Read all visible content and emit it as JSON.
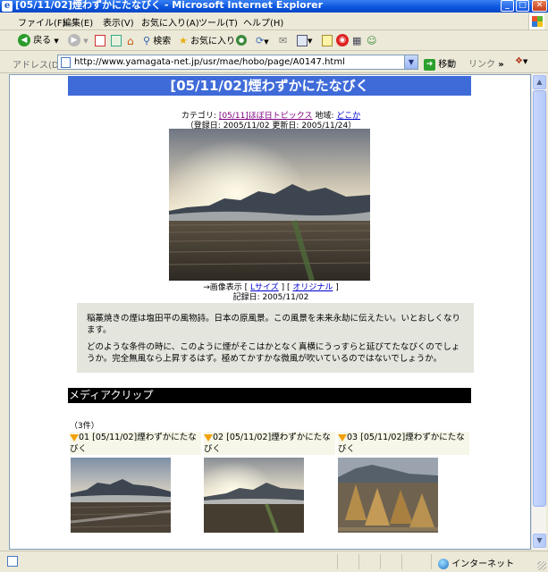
{
  "window": {
    "title": "[05/11/02]煙わずかにたなびく - Microsoft Internet Explorer",
    "minimize": "_",
    "maximize": "□",
    "close": "✕"
  },
  "menu": [
    "ファイル(F)",
    "編集(E)",
    "表示(V)",
    "お気に入り(A)",
    "ツール(T)",
    "ヘルプ(H)"
  ],
  "toolbar": {
    "back": "戻る",
    "search": "検索",
    "favorites": "お気に入り"
  },
  "address": {
    "label": "アドレス(D)",
    "url": "http://www.yamagata-net.jp/usr/mae/hobo/page/A0147.html",
    "go": "移動",
    "links": "リンク",
    "chevron": "»"
  },
  "page": {
    "title": "[05/11/02]煙わずかにたなびく",
    "category_label": "カテゴリ:",
    "category_link": "[05/11]ほぼ日トピックス",
    "region_label": "地域:",
    "region_link": "どこか",
    "dates": "（登録日: 2005/11/02 更新日: 2005/11/24）",
    "image_prefix": "→画像表示 [",
    "image_lsize": "Lサイズ",
    "image_sep": "] [",
    "image_original": "オリジナル",
    "image_suffix": "]",
    "record_date": "記録日: 2005/11/02",
    "description": [
      "稲藁焼きの煙は塩田平の風物詩。日本の原風景。この風景を未来永劫に伝えたい。いとおしくなります。",
      "どのような条件の時に、このように煙がそこはかとなく真横にうっすらと延びてたなびくのでしょうか。完全無風なら上昇するはず。極めてかすかな微風が吹いているのではないでしょうか。"
    ],
    "media_clip_title": "メディアクリップ",
    "count": "（3件）",
    "clips": [
      {
        "no": "01",
        "title": "[05/11/02]煙わずかにたなびく"
      },
      {
        "no": "02",
        "title": "[05/11/02]煙わずかにたなびく"
      },
      {
        "no": "03",
        "title": "[05/11/02]煙わずかにたなびく"
      }
    ]
  },
  "status": {
    "zone": "インターネット"
  },
  "colors": {
    "title_bar": "#0a54de",
    "page_title_bg": "#3f6bd9",
    "desc_bg": "#e4e6de",
    "clip_head_bg": "#f6f7e8",
    "link": "#0000cc",
    "visited_link": "#800080",
    "clip_marker": "#f2a10a"
  }
}
